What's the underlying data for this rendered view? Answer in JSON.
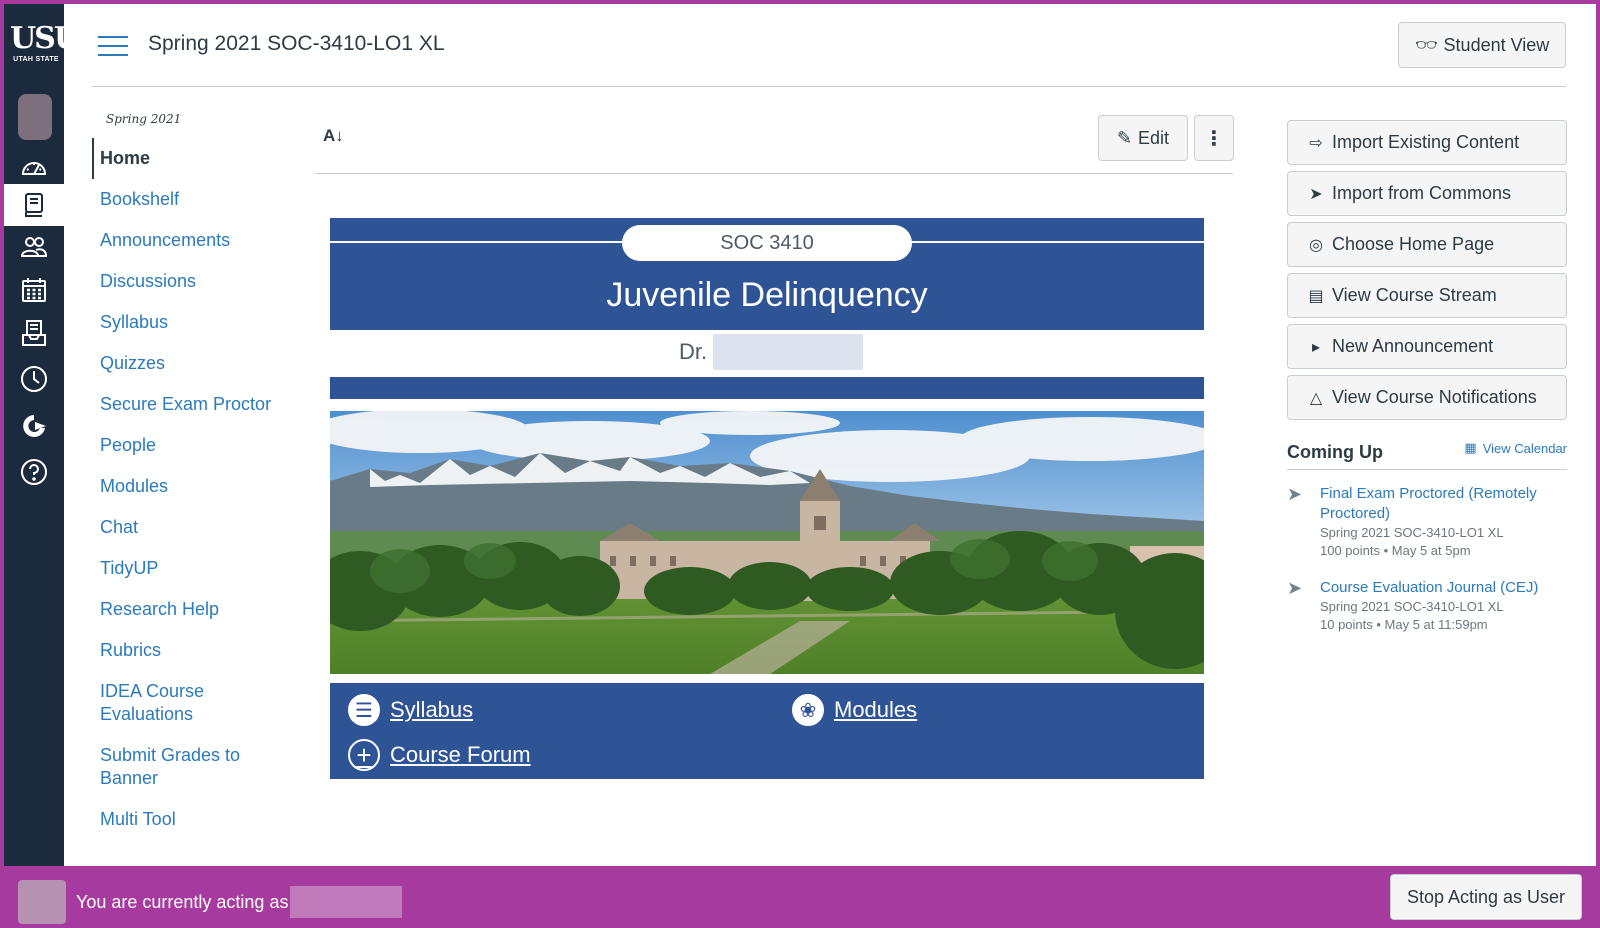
{
  "brand": {
    "logo_text": "USU",
    "logo_sub": "UTAH STATE",
    "accent": "#a73a9f",
    "nav_bg": "#1b2a3c",
    "link": "#2b7abc",
    "banner_blue": "#2f5496"
  },
  "header": {
    "course_title": "Spring 2021 SOC-3410-LO1 XL",
    "student_view": "Student View"
  },
  "global_nav": [
    "account",
    "dashboard",
    "courses",
    "groups",
    "calendar",
    "inbox",
    "history",
    "commons",
    "help"
  ],
  "course_nav": {
    "term": "Spring 2021",
    "items": [
      "Home",
      "Bookshelf",
      "Announcements",
      "Discussions",
      "Syllabus",
      "Quizzes",
      "Secure Exam Proctor",
      "People",
      "Modules",
      "Chat",
      "TidyUP",
      "Research Help",
      "Rubrics",
      "IDEA Course Evaluations",
      "Submit Grades to Banner",
      "Multi Tool"
    ],
    "active": "Home"
  },
  "toolbar": {
    "az_icon": "A↓",
    "edit": "Edit",
    "more": "⋮"
  },
  "content": {
    "course_code": "SOC 3410",
    "course_name": "Juvenile Delinquency",
    "professor_prefix": "Dr.",
    "links": {
      "syllabus": " Syllabus",
      "modules": " Modules",
      "forum": "Course Forum"
    }
  },
  "sidebar": {
    "buttons": [
      "Import Existing Content",
      "Import from Commons",
      "Choose Home Page",
      "View Course Stream",
      "New Announcement",
      "View Course Notifications"
    ],
    "coming_up": "Coming Up",
    "view_calendar": "View Calendar",
    "events": [
      {
        "title": "Final Exam Proctored (Remotely Proctored)",
        "course": "Spring 2021 SOC-3410-LO1 XL",
        "points": "100 points • May 5 at 5pm"
      },
      {
        "title": "Course Evaluation Journal (CEJ)",
        "course": "Spring 2021 SOC-3410-LO1 XL",
        "points": "10 points • May 5 at 11:59pm"
      }
    ]
  },
  "masquerade": {
    "message": "You are currently acting as",
    "stop": "Stop Acting as User"
  }
}
